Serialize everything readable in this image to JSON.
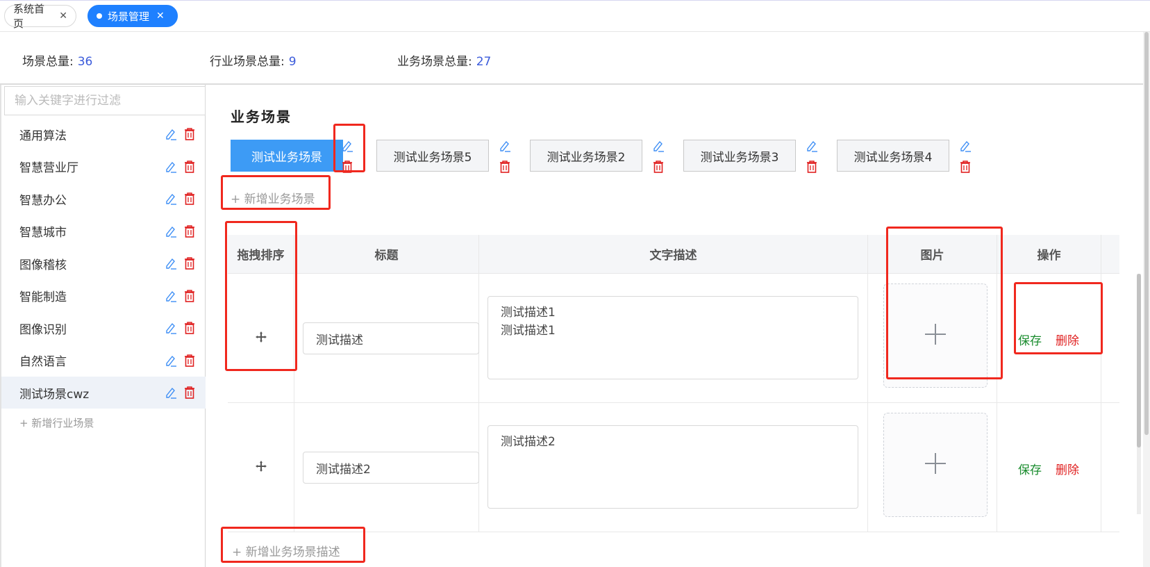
{
  "tabs": [
    {
      "label": "系统首页",
      "close": "✕"
    },
    {
      "label": "场景管理",
      "close": "✕"
    }
  ],
  "stats": [
    {
      "label": "场景总量:",
      "value": "36"
    },
    {
      "label": "行业场景总量:",
      "value": "9"
    },
    {
      "label": "业务场景总量:",
      "value": "27"
    }
  ],
  "sidebar": {
    "filter_placeholder": "输入关键字进行过滤",
    "items": [
      {
        "label": "通用算法"
      },
      {
        "label": "智慧营业厅"
      },
      {
        "label": "智慧办公"
      },
      {
        "label": "智慧城市"
      },
      {
        "label": "图像稽核"
      },
      {
        "label": "智能制造"
      },
      {
        "label": "图像识别"
      },
      {
        "label": "自然语言"
      },
      {
        "label": "测试场景cwz",
        "selected": true
      }
    ],
    "add_label": "+ 新增行业场景"
  },
  "main": {
    "title": "业务场景",
    "scenes": [
      {
        "label": "测试业务场景",
        "active": true
      },
      {
        "label": "测试业务场景5"
      },
      {
        "label": "测试业务场景2"
      },
      {
        "label": "测试业务场景3"
      },
      {
        "label": "测试业务场景4"
      }
    ],
    "add_scene_label": "+ 新增业务场景",
    "table": {
      "headers": [
        "拖拽排序",
        "标题",
        "文字描述",
        "图片",
        "操作"
      ],
      "rows": [
        {
          "title": "测试描述",
          "desc": "测试描述1\n测试描述1",
          "save": "保存",
          "del": "删除"
        },
        {
          "title": "测试描述2",
          "desc": "测试描述2",
          "save": "保存",
          "del": "删除"
        }
      ]
    },
    "add_desc_label": "+ 新增业务场景描述"
  },
  "colors": {
    "primary": "#1e80ff",
    "active_scene": "#3d9bf5",
    "highlight": "#f0281e",
    "save": "#1a8c2e",
    "delete": "#e02020"
  }
}
